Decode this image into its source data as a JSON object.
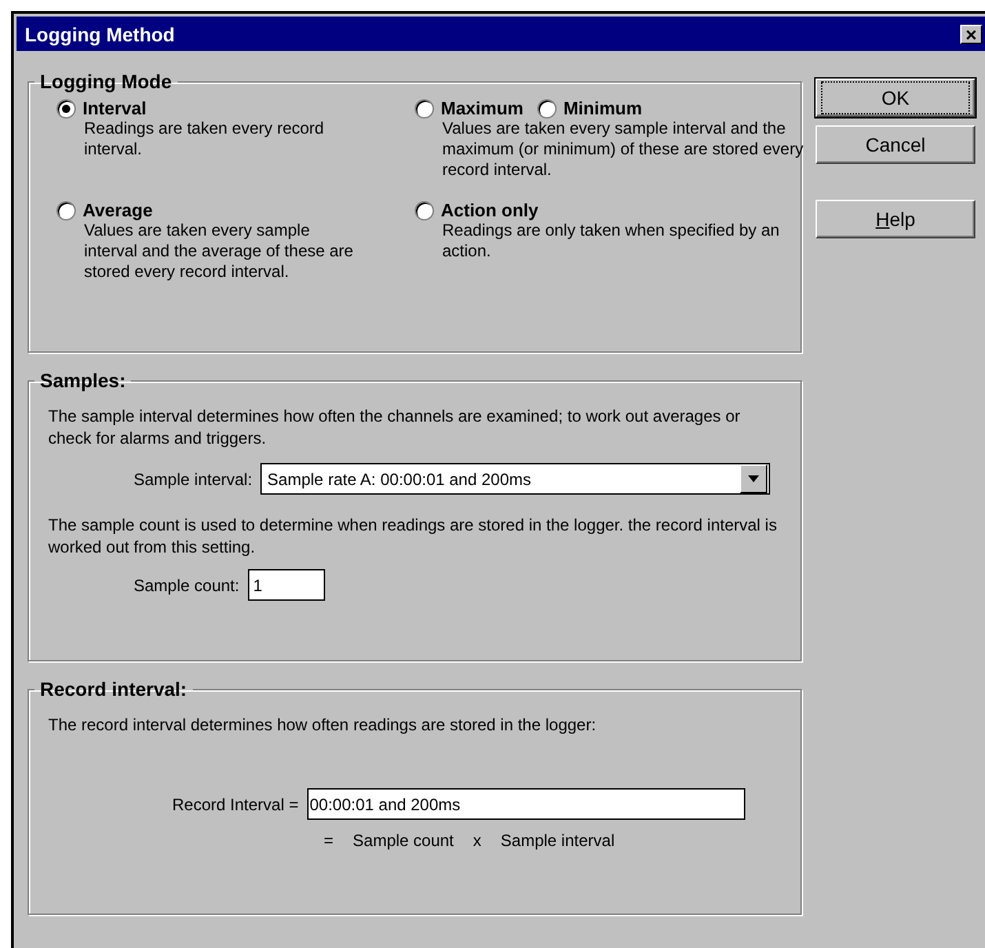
{
  "window": {
    "title": "Logging Method",
    "close": "×"
  },
  "logging_mode": {
    "title": "Logging Mode",
    "modes": [
      {
        "radios": [
          {
            "label": "Interval",
            "selected": true
          }
        ],
        "description": "Readings are taken every record interval."
      },
      {
        "radios": [
          {
            "label": "Maximum",
            "selected": false
          },
          {
            "label": "Minimum",
            "selected": false
          }
        ],
        "description": "Values are taken every sample interval and the maximum (or minimum) of these are stored every record interval."
      },
      {
        "radios": [
          {
            "label": "Average",
            "selected": false
          }
        ],
        "description": "Values are taken every sample interval and the average of these are stored every record interval."
      },
      {
        "radios": [
          {
            "label": "Action only",
            "selected": false
          }
        ],
        "description": "Readings are only taken when specified by an action."
      }
    ]
  },
  "samples": {
    "title": "Samples:",
    "description": "The sample interval determines how often the channels are examined; to work out averages or check for alarms and triggers.",
    "interval_label": "Sample interval:",
    "interval_value": "Sample rate A: 00:00:01 and 200ms",
    "count_description": "The sample count is used to determine when readings are stored in the logger. the record interval is worked out from this setting.",
    "count_label": "Sample count:",
    "count_value": "1"
  },
  "record_interval": {
    "title": "Record interval:",
    "description": "The record interval determines how often readings are stored in the logger:",
    "label": "Record Interval =",
    "value": "00:00:01 and 200ms",
    "formula": [
      "=",
      "Sample count",
      "x",
      "Sample interval"
    ]
  },
  "buttons": [
    {
      "label": "OK",
      "default": true,
      "underline_first": false
    },
    {
      "label": "Cancel",
      "default": false,
      "underline_first": false
    },
    {
      "label": "Help",
      "default": false,
      "underline_first": true
    }
  ]
}
